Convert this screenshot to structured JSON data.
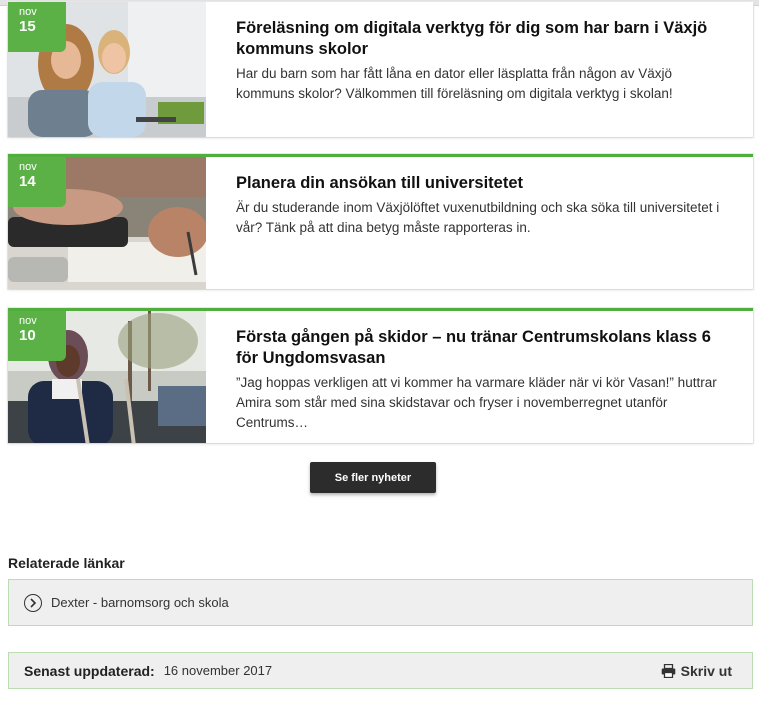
{
  "news": [
    {
      "month": "nov",
      "day": "15",
      "title": "Föreläsning om digitala verktyg för dig som har barn i Växjö kommuns skolor",
      "text": "Har du barn som har fått låna en dator eller läsplatta från någon av Växjö kommuns skolor? Välkommen till föreläsning om digitala verktyg i skolan!"
    },
    {
      "month": "nov",
      "day": "14",
      "title": "Planera din ansökan till universitetet",
      "text": "Är du studerande inom Växjölöftet vuxenutbildning och ska söka till universitetet i vår? Tänk på att dina betyg måste rapporteras in."
    },
    {
      "month": "nov",
      "day": "10",
      "title": "Första gången på skidor – nu tränar Centrumskolans klass 6 för Ungdomsvasan",
      "text": "”Jag hoppas verkligen att vi kommer ha varmare kläder när vi kör Vasan!” huttrar Amira som står med sina skidstavar och fryser i novemberregnet utanför Centrums…"
    }
  ],
  "more_button": "Se fler nyheter",
  "related": {
    "heading": "Relaterade länkar",
    "link": "Dexter - barnomsorg och skola"
  },
  "footer": {
    "updated_label": "Senast uppdaterad:",
    "updated_date": "16 november 2017",
    "print_label": "Skriv ut"
  },
  "colors": {
    "accent": "#5bb146",
    "button": "#2c2c2c"
  }
}
